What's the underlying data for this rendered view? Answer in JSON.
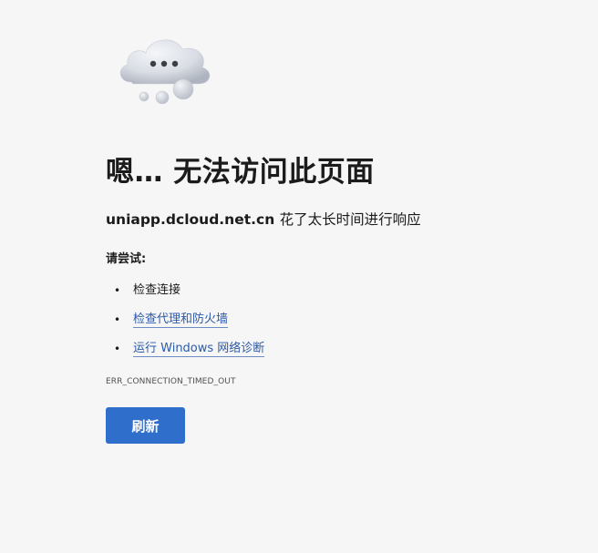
{
  "icon": {
    "name": "cloud-thinking-icon",
    "colors": {
      "cloud_light": "#eef0f4",
      "cloud_dark": "#b7bcc6",
      "dots": "#3b3f46"
    }
  },
  "error": {
    "title": "嗯… 无法访问此页面",
    "host": "uniapp.dcloud.net.cn",
    "message": "花了太长时间进行响应",
    "try_label": "请尝试:",
    "suggestions": [
      {
        "text": "检查连接",
        "link": false
      },
      {
        "text": "检查代理和防火墙",
        "link": true
      },
      {
        "text": "运行 Windows 网络诊断",
        "link": true
      }
    ],
    "code": "ERR_CONNECTION_TIMED_OUT"
  },
  "actions": {
    "refresh_label": "刷新",
    "accent": "#2f6fcb",
    "link_color": "#2b5aa8"
  }
}
